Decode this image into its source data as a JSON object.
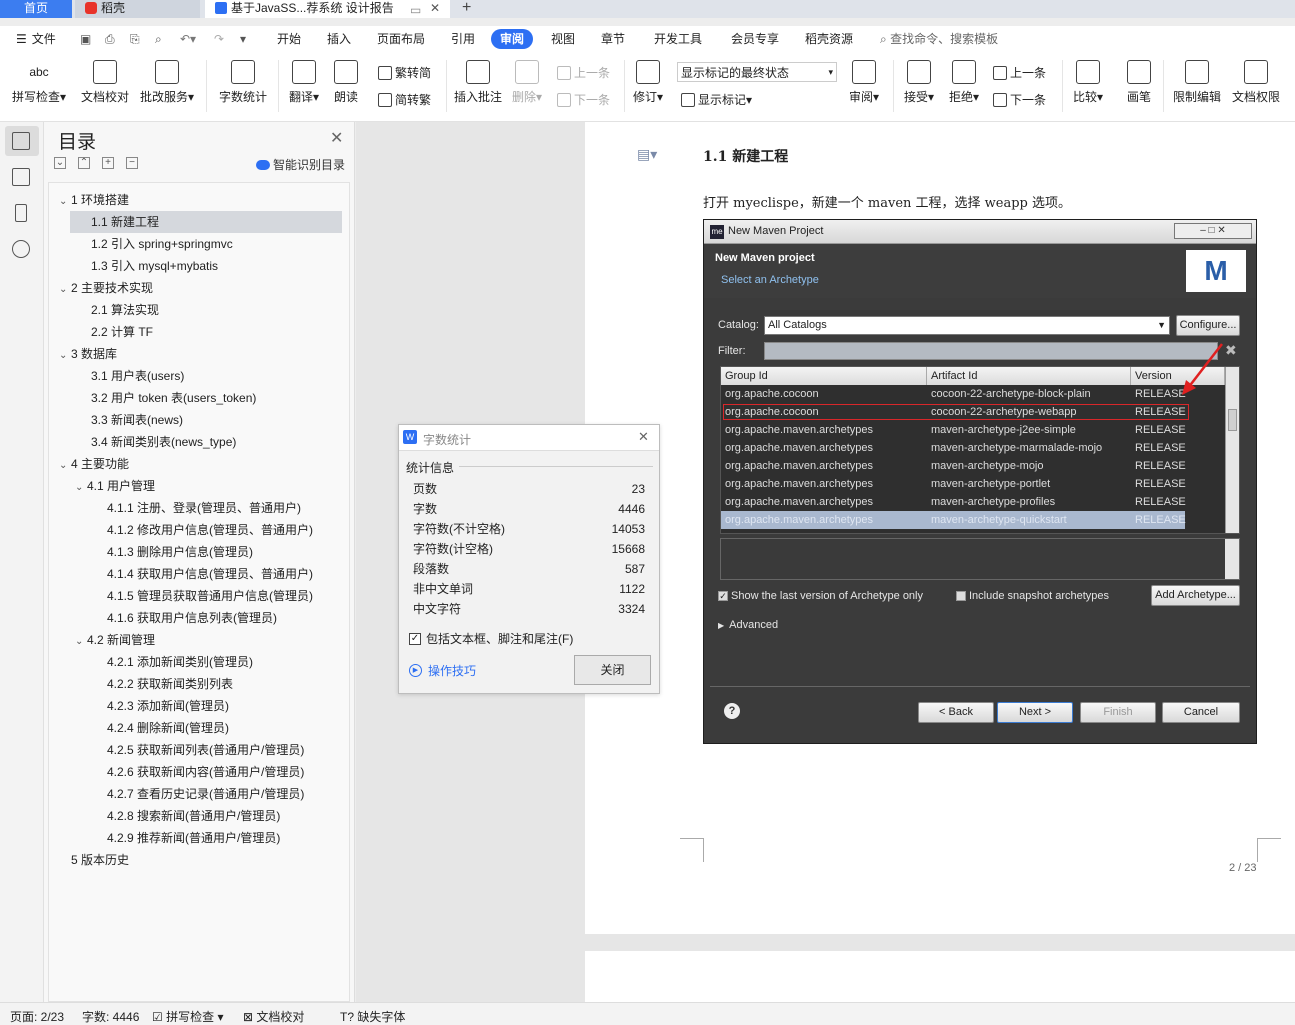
{
  "tabs": {
    "home": "首页",
    "daoke": "稻壳",
    "doc": "基于JavaSS...荐系统 设计报告",
    "add": "+"
  },
  "menu": {
    "file": "文件",
    "items": [
      "开始",
      "插入",
      "页面布局",
      "引用",
      "审阅",
      "视图",
      "章节",
      "开发工具",
      "会员专享",
      "稻壳资源"
    ],
    "search": "查找命令、搜索模板"
  },
  "ribbon": {
    "spell": "拼写检查",
    "doc_check": "文档校对",
    "batch": "批改服务",
    "word_count": "字数统计",
    "translate": "翻译",
    "read": "朗读",
    "to_simplified": "繁转简",
    "to_traditional": "简转繁",
    "insert_comment": "插入批注",
    "delete": "删除",
    "prev": "上一条",
    "next": "下一条",
    "revise": "修订",
    "markup_state": "显示标记的最终状态",
    "show_markup": "显示标记",
    "review": "审阅",
    "accept": "接受",
    "reject": "拒绝",
    "prev2": "上一条",
    "next2": "下一条",
    "compare": "比较",
    "pen": "画笔",
    "restrict": "限制编辑",
    "rights": "文档权限"
  },
  "toc": {
    "title": "目录",
    "smart": "智能识别目录",
    "items": [
      {
        "label": "1  环境搭建",
        "level": 1,
        "arrow": true
      },
      {
        "label": "1.1  新建工程",
        "level": 2,
        "selected": true
      },
      {
        "label": "1.2  引入 spring+springmvc",
        "level": 2
      },
      {
        "label": "1.3  引入 mysql+mybatis",
        "level": 2
      },
      {
        "label": "2  主要技术实现",
        "level": 1,
        "arrow": true
      },
      {
        "label": "2.1  算法实现",
        "level": 2
      },
      {
        "label": "2.2  计算 TF",
        "level": 2
      },
      {
        "label": "3  数据库",
        "level": 1,
        "arrow": true
      },
      {
        "label": "3.1  用户表(users)",
        "level": 2
      },
      {
        "label": "3.2  用户 token 表(users_token)",
        "level": 2
      },
      {
        "label": "3.3  新闻表(news)",
        "level": 2
      },
      {
        "label": "3.4  新闻类别表(news_type)",
        "level": 2
      },
      {
        "label": "4  主要功能",
        "level": 1,
        "arrow": true
      },
      {
        "label": "4.1  用户管理",
        "level": 2,
        "arrow": true
      },
      {
        "label": "4.1.1  注册、登录(管理员、普通用户)",
        "level": 3
      },
      {
        "label": "4.1.2  修改用户信息(管理员、普通用户)",
        "level": 3
      },
      {
        "label": "4.1.3  删除用户信息(管理员)",
        "level": 3
      },
      {
        "label": "4.1.4  获取用户信息(管理员、普通用户)",
        "level": 3
      },
      {
        "label": "4.1.5  管理员获取普通用户信息(管理员)",
        "level": 3
      },
      {
        "label": "4.1.6  获取用户信息列表(管理员)",
        "level": 3
      },
      {
        "label": "4.2  新闻管理",
        "level": 2,
        "arrow": true
      },
      {
        "label": "4.2.1  添加新闻类别(管理员)",
        "level": 3
      },
      {
        "label": "4.2.2  获取新闻类别列表",
        "level": 3
      },
      {
        "label": "4.2.3  添加新闻(管理员)",
        "level": 3
      },
      {
        "label": "4.2.4  删除新闻(管理员)",
        "level": 3
      },
      {
        "label": "4.2.5  获取新闻列表(普通用户/管理员)",
        "level": 3
      },
      {
        "label": "4.2.6  获取新闻内容(普通用户/管理员)",
        "level": 3
      },
      {
        "label": "4.2.7  查看历史记录(普通用户/管理员)",
        "level": 3
      },
      {
        "label": "4.2.8  搜索新闻(普通用户/管理员)",
        "level": 3
      },
      {
        "label": "4.2.9  推荐新闻(普通用户/管理员)",
        "level": 3
      },
      {
        "label": "5  版本历史",
        "level": 1,
        "arrow": false
      }
    ]
  },
  "word_dialog": {
    "title": "字数统计",
    "section": "统计信息",
    "rows": [
      {
        "label": "页数",
        "value": "23"
      },
      {
        "label": "字数",
        "value": "4446"
      },
      {
        "label": "字符数(不计空格)",
        "value": "14053"
      },
      {
        "label": "字符数(计空格)",
        "value": "15668"
      },
      {
        "label": "段落数",
        "value": "587"
      },
      {
        "label": "非中文单词",
        "value": "1122"
      },
      {
        "label": "中文字符",
        "value": "3324"
      }
    ],
    "include_label": "包括文本框、脚注和尾注(F)",
    "tips": "操作技巧",
    "close": "关闭"
  },
  "document": {
    "heading": "1.1 新建工程",
    "para": "打开 myeclispe，新建一个 maven 工程，选择 weapp 选项。",
    "page_number": "2 / 23"
  },
  "maven": {
    "title": "New Maven Project",
    "header": "New Maven project",
    "subheader": "Select an Archetype",
    "catalog_label": "Catalog:",
    "catalog_value": "All Catalogs",
    "configure": "Configure...",
    "filter_label": "Filter:",
    "columns": [
      "Group Id",
      "Artifact Id",
      "Version"
    ],
    "rows": [
      [
        "org.apache.cocoon",
        "cocoon-22-archetype-block-plain",
        "RELEASE"
      ],
      [
        "org.apache.cocoon",
        "cocoon-22-archetype-webapp",
        "RELEASE"
      ],
      [
        "org.apache.maven.archetypes",
        "maven-archetype-j2ee-simple",
        "RELEASE"
      ],
      [
        "org.apache.maven.archetypes",
        "maven-archetype-marmalade-mojo",
        "RELEASE"
      ],
      [
        "org.apache.maven.archetypes",
        "maven-archetype-mojo",
        "RELEASE"
      ],
      [
        "org.apache.maven.archetypes",
        "maven-archetype-portlet",
        "RELEASE"
      ],
      [
        "org.apache.maven.archetypes",
        "maven-archetype-profiles",
        "RELEASE"
      ],
      [
        "org.apache.maven.archetypes",
        "maven-archetype-quickstart",
        "RELEASE"
      ]
    ],
    "show_last": "Show the last version of Archetype only",
    "include_snapshot": "Include snapshot archetypes",
    "add_archetype": "Add Archetype...",
    "advanced": "Advanced",
    "back": "< Back",
    "next": "Next >",
    "finish": "Finish",
    "cancel": "Cancel"
  },
  "status": {
    "page": "页面: 2/23",
    "words": "字数: 4446",
    "spell": "拼写检查",
    "proof": "文档校对",
    "font": "缺失字体"
  },
  "colors": {
    "accent": "#2d6ff3",
    "highlight_red": "#d9272a"
  }
}
